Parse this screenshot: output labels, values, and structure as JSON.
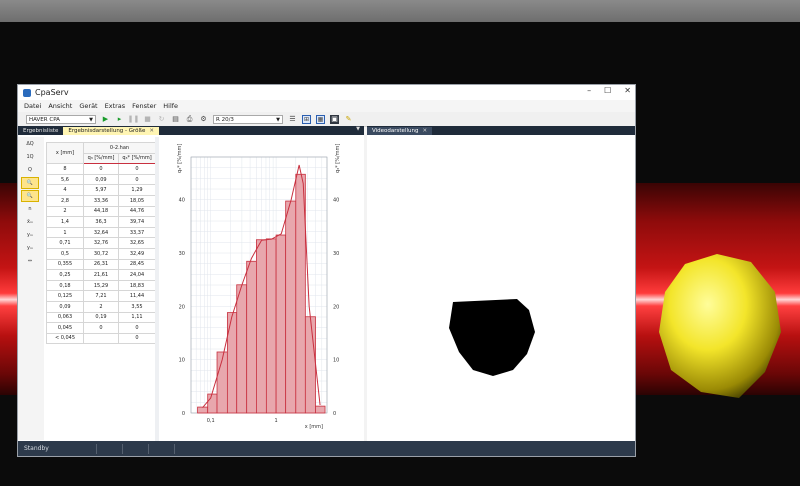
{
  "app": {
    "title": "CpaServ",
    "window_controls": [
      "–",
      "☐",
      "✕"
    ]
  },
  "menu": [
    "Datei",
    "Ansicht",
    "Gerät",
    "Extras",
    "Fenster",
    "Hilfe"
  ],
  "toolbar": {
    "device": "HAVER CPA",
    "profile": "R 20/3"
  },
  "left_tabs": [
    {
      "label": "Ergebnisliste",
      "active": false
    },
    {
      "label": "Ergebnisdarstellung - Größe",
      "active": true
    }
  ],
  "right_tabs": [
    {
      "label": "Videodarstellung",
      "active": true
    }
  ],
  "side_tools": [
    "ΔQ",
    "1Q",
    "Q",
    "🔍",
    "🔍",
    "n",
    "x̄ₘ",
    "yₘ",
    "yₘ",
    "⇔"
  ],
  "table": {
    "file": "0-2.han",
    "headers": [
      "x [mm]",
      "q₃ [%/mm]",
      "q₃* [%/mm]"
    ],
    "rows": [
      [
        "8",
        "0",
        "0"
      ],
      [
        "5,6",
        "0,09",
        "0"
      ],
      [
        "4",
        "5,97",
        "1,29"
      ],
      [
        "2,8",
        "33,36",
        "18,05"
      ],
      [
        "2",
        "44,18",
        "44,76"
      ],
      [
        "1,4",
        "36,3",
        "39,74"
      ],
      [
        "1",
        "32,64",
        "33,37"
      ],
      [
        "0,71",
        "32,76",
        "32,65"
      ],
      [
        "0,5",
        "30,72",
        "32,49"
      ],
      [
        "0,355",
        "26,31",
        "28,45"
      ],
      [
        "0,25",
        "21,61",
        "24,04"
      ],
      [
        "0,18",
        "15,29",
        "18,83"
      ],
      [
        "0,125",
        "7,21",
        "11,44"
      ],
      [
        "0,09",
        "2",
        "3,55"
      ],
      [
        "0,063",
        "0,19",
        "1,11"
      ],
      [
        "0,045",
        "0",
        "0"
      ],
      [
        "< 0,045",
        "",
        "0"
      ]
    ]
  },
  "chart_data": {
    "type": "bar",
    "ylabel": "q₃* [%/mm]",
    "xlabel": "x [mm]",
    "xscale": "log",
    "xticks": [
      "0,1",
      "1"
    ],
    "yticks": [
      "0",
      "10",
      "20",
      "30",
      "40"
    ],
    "ylim": [
      0,
      48
    ],
    "bins": [
      {
        "lo": 0.063,
        "hi": 0.09,
        "value": 1.11
      },
      {
        "lo": 0.09,
        "hi": 0.125,
        "value": 3.55
      },
      {
        "lo": 0.125,
        "hi": 0.18,
        "value": 11.44
      },
      {
        "lo": 0.18,
        "hi": 0.25,
        "value": 18.83
      },
      {
        "lo": 0.25,
        "hi": 0.355,
        "value": 24.04
      },
      {
        "lo": 0.355,
        "hi": 0.5,
        "value": 28.45
      },
      {
        "lo": 0.5,
        "hi": 0.71,
        "value": 32.49
      },
      {
        "lo": 0.71,
        "hi": 1,
        "value": 32.65
      },
      {
        "lo": 1,
        "hi": 1.4,
        "value": 33.37
      },
      {
        "lo": 1.4,
        "hi": 2,
        "value": 39.74
      },
      {
        "lo": 2,
        "hi": 2.8,
        "value": 44.76
      },
      {
        "lo": 2.8,
        "hi": 4,
        "value": 18.05
      },
      {
        "lo": 4,
        "hi": 5.6,
        "value": 1.29
      }
    ],
    "curve": [
      {
        "x": 0.075,
        "y": 1
      },
      {
        "x": 0.1,
        "y": 2.8
      },
      {
        "x": 0.15,
        "y": 10
      },
      {
        "x": 0.21,
        "y": 18
      },
      {
        "x": 0.3,
        "y": 24
      },
      {
        "x": 0.42,
        "y": 29
      },
      {
        "x": 0.6,
        "y": 32.4
      },
      {
        "x": 0.85,
        "y": 32.6
      },
      {
        "x": 1.2,
        "y": 33.6
      },
      {
        "x": 1.7,
        "y": 40
      },
      {
        "x": 2.25,
        "y": 46.5
      },
      {
        "x": 2.6,
        "y": 43
      },
      {
        "x": 3.2,
        "y": 20
      },
      {
        "x": 4.7,
        "y": 1.5
      }
    ],
    "colors": {
      "bar": "#c8303f",
      "bar_fill": "#e8a7ad",
      "grid": "#e0e6ec"
    }
  },
  "status": {
    "text": "Standby"
  },
  "colors": {
    "accent": "#2b5fb0",
    "tab_active": "#fff5b3",
    "tabstrip": "#1f2b3a"
  }
}
